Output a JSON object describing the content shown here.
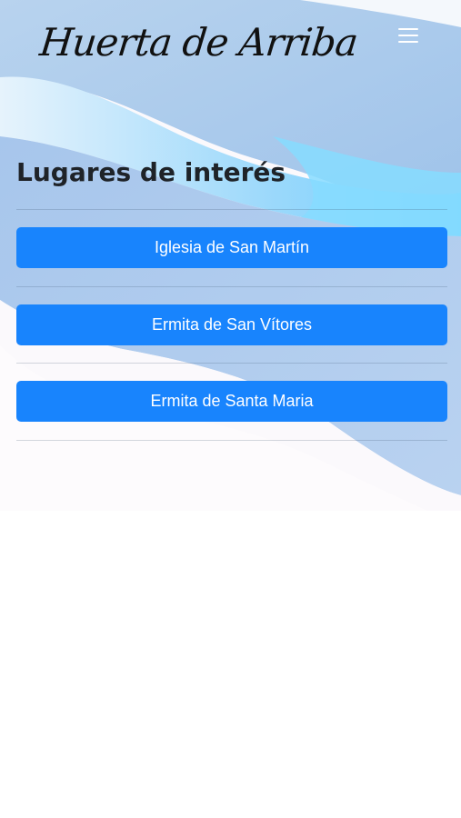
{
  "header": {
    "site_title": "Huerta de Arriba",
    "menu_icon": "hamburger-menu-icon"
  },
  "main": {
    "section_title": "Lugares de interés",
    "places": [
      {
        "label": "Iglesia de San Martín"
      },
      {
        "label": "Ermita de San Vítores"
      },
      {
        "label": "Ermita de Santa Maria"
      }
    ]
  },
  "colors": {
    "button": "#1884fd",
    "button_text": "#ffffff",
    "heading": "#1f2328",
    "background_wave_light": "#b9d3ee",
    "background_wave_cyan": "#8fdcff"
  }
}
